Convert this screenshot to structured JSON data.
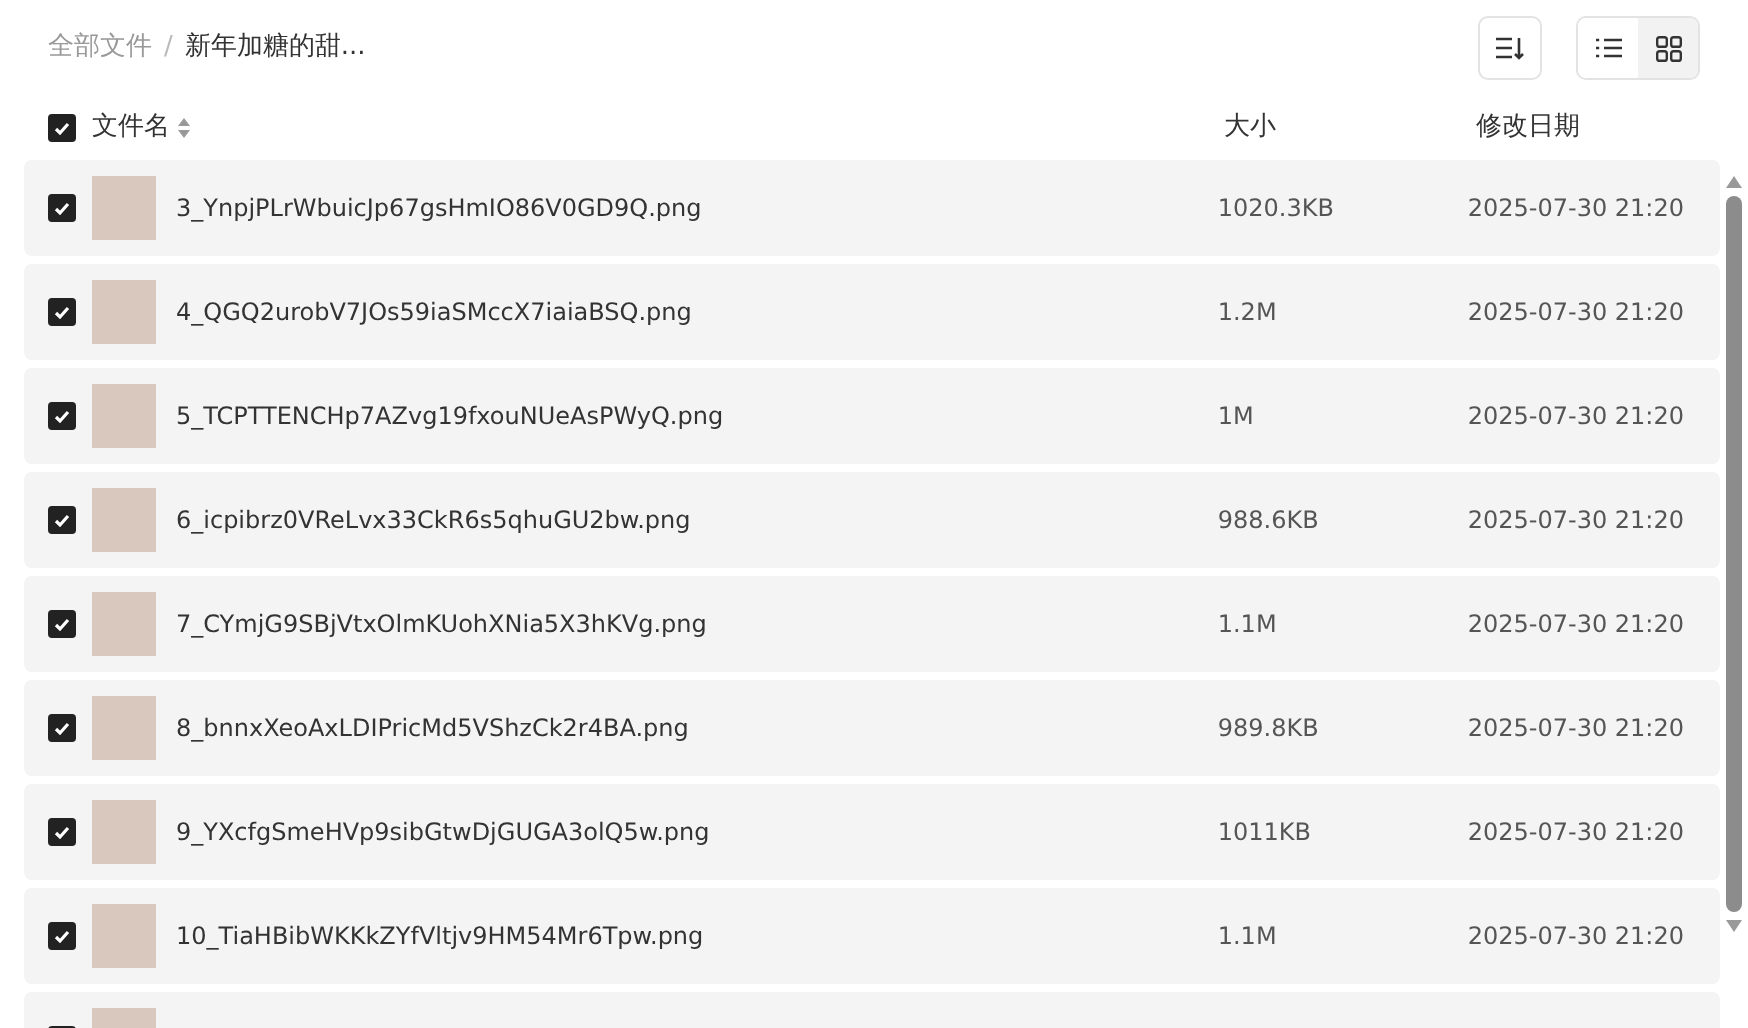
{
  "breadcrumb": [
    {
      "label": "全部文件",
      "current": false
    },
    {
      "label": "新年加糖的甜...",
      "current": true
    }
  ],
  "breadcrumb_separator": "/",
  "view_modes": [
    {
      "kind": "list",
      "selected": false
    },
    {
      "kind": "grid",
      "selected": true
    }
  ],
  "table": {
    "select_all_checked": true,
    "columns": [
      "文件名",
      "大小",
      "修改日期"
    ],
    "rows": [
      {
        "checked": true,
        "name": "3_YnpjPLrWbuicJp67gsHmIO86V0GD9Q.png",
        "size": "1020.3KB",
        "modified": "2025-07-30 21:20"
      },
      {
        "checked": true,
        "name": "4_QGQ2urobV7JOs59iaSMccX7iaiaBSQ.png",
        "size": "1.2M",
        "modified": "2025-07-30 21:20"
      },
      {
        "checked": true,
        "name": "5_TCPTTENCHp7AZvg19fxouNUeAsPWyQ.png",
        "size": "1M",
        "modified": "2025-07-30 21:20"
      },
      {
        "checked": true,
        "name": "6_icpibrz0VReLvx33CkR6s5qhuGU2bw.png",
        "size": "988.6KB",
        "modified": "2025-07-30 21:20"
      },
      {
        "checked": true,
        "name": "7_CYmjG9SBjVtxOlmKUohXNia5X3hKVg.png",
        "size": "1.1M",
        "modified": "2025-07-30 21:20"
      },
      {
        "checked": true,
        "name": "8_bnnxXeoAxLDIPricMd5VShzCk2r4BA.png",
        "size": "989.8KB",
        "modified": "2025-07-30 21:20"
      },
      {
        "checked": true,
        "name": "9_YXcfgSmeHVp9sibGtwDjGUGA3olQ5w.png",
        "size": "1011KB",
        "modified": "2025-07-30 21:20"
      },
      {
        "checked": true,
        "name": "10_TiaHBibWKKkZYfVltjv9HM54Mr6Tpw.png",
        "size": "1.1M",
        "modified": "2025-07-30 21:20"
      }
    ],
    "partial_row": {
      "checked": true
    }
  }
}
